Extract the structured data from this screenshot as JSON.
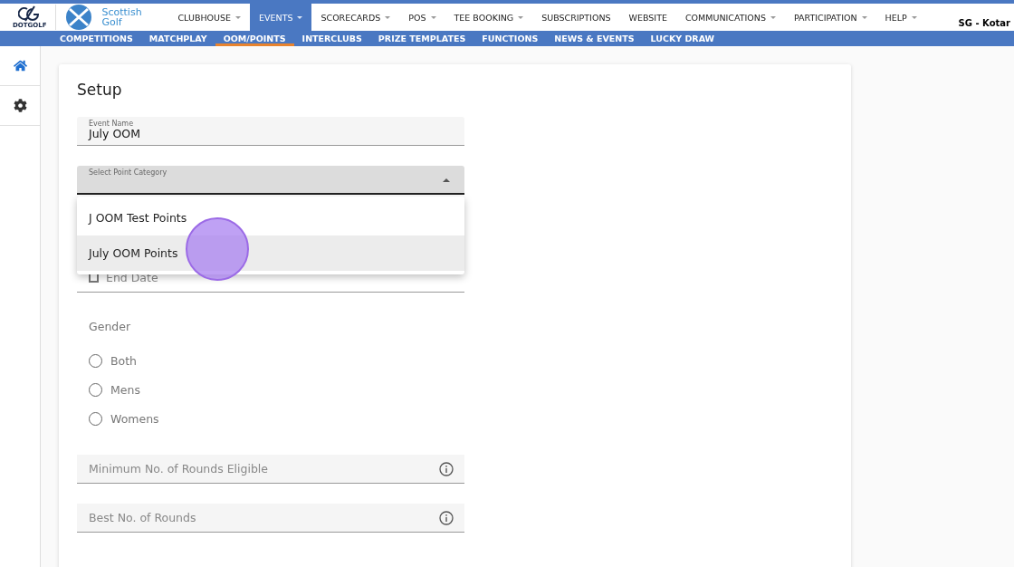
{
  "brand": {
    "logo_text": "DOTGOLF",
    "partner_text": "Scottish Golf"
  },
  "nav": [
    {
      "label": "CLUBHOUSE",
      "caret": true,
      "selected": false
    },
    {
      "label": "EVENTS",
      "caret": true,
      "selected": true
    },
    {
      "label": "SCORECARDS",
      "caret": true,
      "selected": false
    },
    {
      "label": "POS",
      "caret": true,
      "selected": false
    },
    {
      "label": "TEE BOOKING",
      "caret": true,
      "selected": false
    },
    {
      "label": "SUBSCRIPTIONS",
      "caret": false,
      "selected": false
    },
    {
      "label": "WEBSITE",
      "caret": false,
      "selected": false
    },
    {
      "label": "COMMUNICATIONS",
      "caret": true,
      "selected": false
    },
    {
      "label": "PARTICIPATION",
      "caret": true,
      "selected": false
    },
    {
      "label": "HELP",
      "caret": true,
      "selected": false
    }
  ],
  "user": "SG - Kotar",
  "subnav": [
    {
      "label": "COMPETITIONS",
      "selected": false
    },
    {
      "label": "MATCHPLAY",
      "selected": false
    },
    {
      "label": "OOM/POINTS",
      "selected": true
    },
    {
      "label": "INTERCLUBS",
      "selected": false
    },
    {
      "label": "PRIZE TEMPLATES",
      "selected": false
    },
    {
      "label": "FUNCTIONS",
      "selected": false
    },
    {
      "label": "NEWS & EVENTS",
      "selected": false
    },
    {
      "label": "LUCKY DRAW",
      "selected": false
    }
  ],
  "sidebar": [
    {
      "kind": "home",
      "selected": true
    },
    {
      "kind": "settings",
      "selected": false
    }
  ],
  "form": {
    "title": "Setup",
    "event_name": {
      "label": "Event Name",
      "value": "July OOM"
    },
    "point_category": {
      "label": "Select Point Category",
      "expanded": true,
      "options": [
        {
          "label": "J OOM Test Points",
          "selected": false
        },
        {
          "label": "July OOM Points",
          "selected": true
        }
      ]
    },
    "end_date": {
      "placeholder": "End Date"
    },
    "gender": {
      "label": "Gender",
      "options": [
        {
          "label": "Both",
          "checked": false
        },
        {
          "label": "Mens",
          "checked": false
        },
        {
          "label": "Womens",
          "checked": false
        }
      ]
    },
    "number_fields": [
      {
        "placeholder": "Minimum No. of Rounds Eligible"
      },
      {
        "placeholder": "Best No. of Rounds"
      }
    ]
  },
  "click_marker": true
}
